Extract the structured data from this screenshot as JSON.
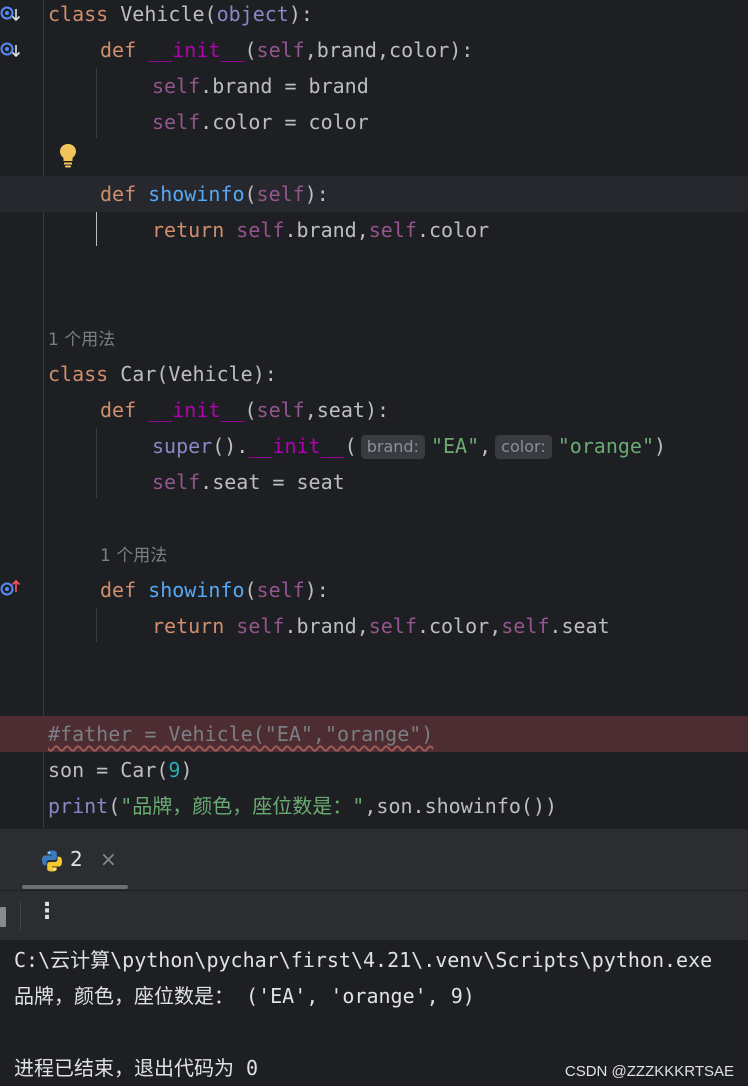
{
  "editor": {
    "lines": {
      "l1": {
        "kw": "class",
        "name": " Vehicle(",
        "base": "object",
        "end": "):"
      },
      "l2": {
        "kw": "def",
        "name": "__init__",
        "p1": "self",
        "p2": "brand",
        "p3": "color",
        "end": "):"
      },
      "l3": {
        "self": "self",
        "rest": ".brand = brand"
      },
      "l4": {
        "self": "self",
        "rest": ".color = color"
      },
      "l6": {
        "kw": "def",
        "name": "showinfo",
        "self": "self",
        "end": "):"
      },
      "l7": {
        "kw": "return",
        "s1": "self",
        "a1": ".brand",
        "s2": "self",
        "a2": ".color"
      },
      "usage1": "1 个用法",
      "l10": {
        "kw": "class",
        "rest": " Car(Vehicle):"
      },
      "l11": {
        "kw": "def",
        "name": "__init__",
        "p1": "self",
        "p2": "seat",
        "end": "):"
      },
      "l12": {
        "fn": "super",
        "mid": "().",
        "name": "__init__",
        "paren": "(",
        "hint1": "brand:",
        "v1": "\"EA\"",
        "hint2": "color:",
        "v2": "\"orange\"",
        "end": ")"
      },
      "l13": {
        "self": "self",
        "rest": ".seat = seat"
      },
      "usage2": "1 个用法",
      "l16": {
        "kw": "def",
        "name": "showinfo",
        "self": "self",
        "end": "):"
      },
      "l17": {
        "kw": "return",
        "s1": "self",
        "a1": ".brand",
        "s2": "self",
        "a2": ".color",
        "s3": "self",
        "a3": ".seat"
      },
      "l20": {
        "comment": "#father = Vehicle(\"EA\",\"orange\")"
      },
      "l21": {
        "pre": "son = Car(",
        "num": "9",
        "end": ")"
      },
      "l22": {
        "fn": "print",
        "paren": "(",
        "str": "\"品牌，颜色，座位数是：\"",
        "rest": "son.showinfo())"
      }
    }
  },
  "toolwindow": {
    "tab_number": "2",
    "tab_close": "×",
    "more": "⋮"
  },
  "console": {
    "cmd": "C:\\云计算\\python\\pychar\\first\\4.21\\.venv\\Scripts\\python.exe",
    "output": "品牌，颜色，座位数是： ('EA', 'orange', 9)",
    "exit": "进程已结束，退出代码为 0"
  },
  "watermark": "CSDN @ZZZKKKRTSAE",
  "colors": {
    "keyword": "#cf8e6d",
    "self": "#94558d",
    "function": "#56a8f5",
    "string": "#6aab73",
    "number": "#2aacb8",
    "dunder": "#b200b2"
  }
}
